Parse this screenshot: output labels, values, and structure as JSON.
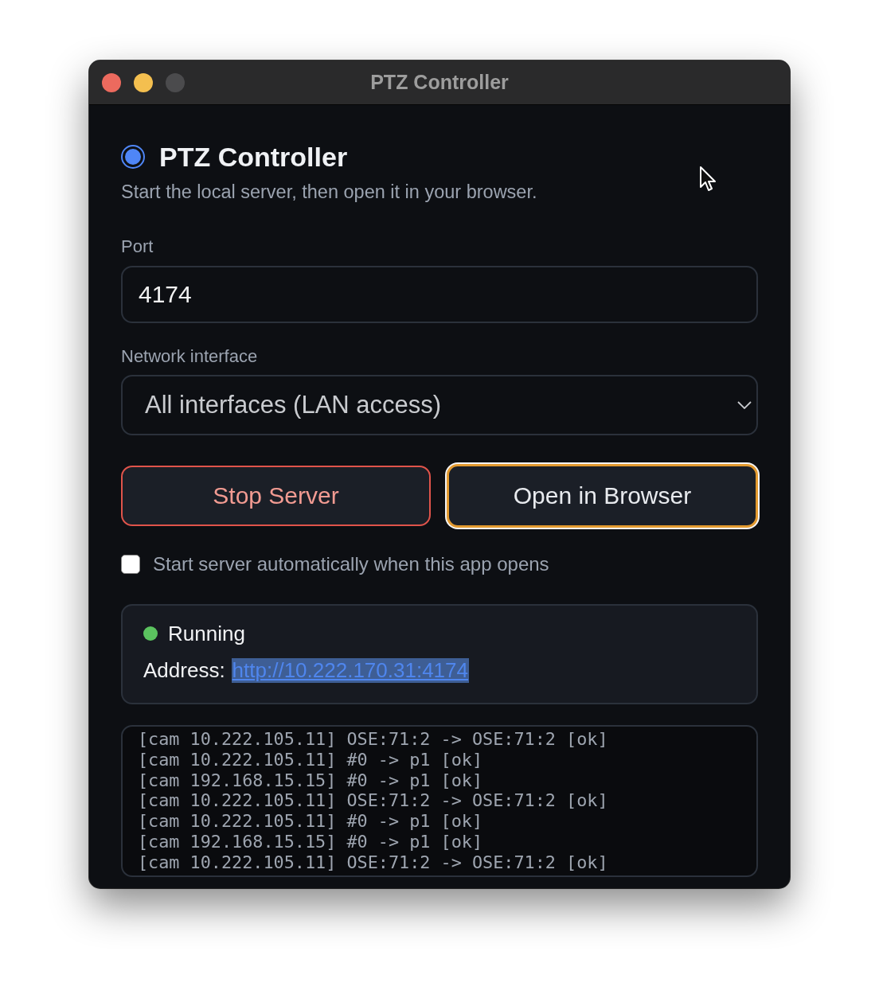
{
  "window": {
    "title": "PTZ Controller",
    "controls": [
      {
        "kind": "close",
        "disabled": false
      },
      {
        "kind": "minimize",
        "disabled": false
      },
      {
        "kind": "zoom",
        "disabled": true
      }
    ]
  },
  "header": {
    "title": "PTZ Controller",
    "subtitle": "Start the local server, then open it in your browser."
  },
  "port": {
    "label": "Port",
    "value": "4174"
  },
  "network_interface": {
    "label": "Network interface",
    "value": "All interfaces (LAN access)"
  },
  "buttons": [
    {
      "kind": "danger",
      "label": "Stop Server",
      "focused": false
    },
    {
      "kind": "primary",
      "label": "Open in Browser",
      "focused": true
    }
  ],
  "autostart": {
    "label": "Start server automatically when this app opens",
    "checked": false
  },
  "status": {
    "text": "Running",
    "running": true,
    "address_label": "Address:",
    "address": "http://10.222.170.31:4174",
    "address_selected": true
  },
  "log": [
    "[cam 10.222.105.11] OSE:71:2 -> OSE:71:2 [ok]",
    "[cam 10.222.105.11] #0 -> p1 [ok]",
    "[cam 192.168.15.15] #0 -> p1 [ok]",
    "[cam 10.222.105.11] OSE:71:2 -> OSE:71:2 [ok]",
    "[cam 10.222.105.11] #0 -> p1 [ok]",
    "[cam 192.168.15.15] #0 -> p1 [ok]",
    "[cam 10.222.105.11] OSE:71:2 -> OSE:71:2 [ok]"
  ]
}
